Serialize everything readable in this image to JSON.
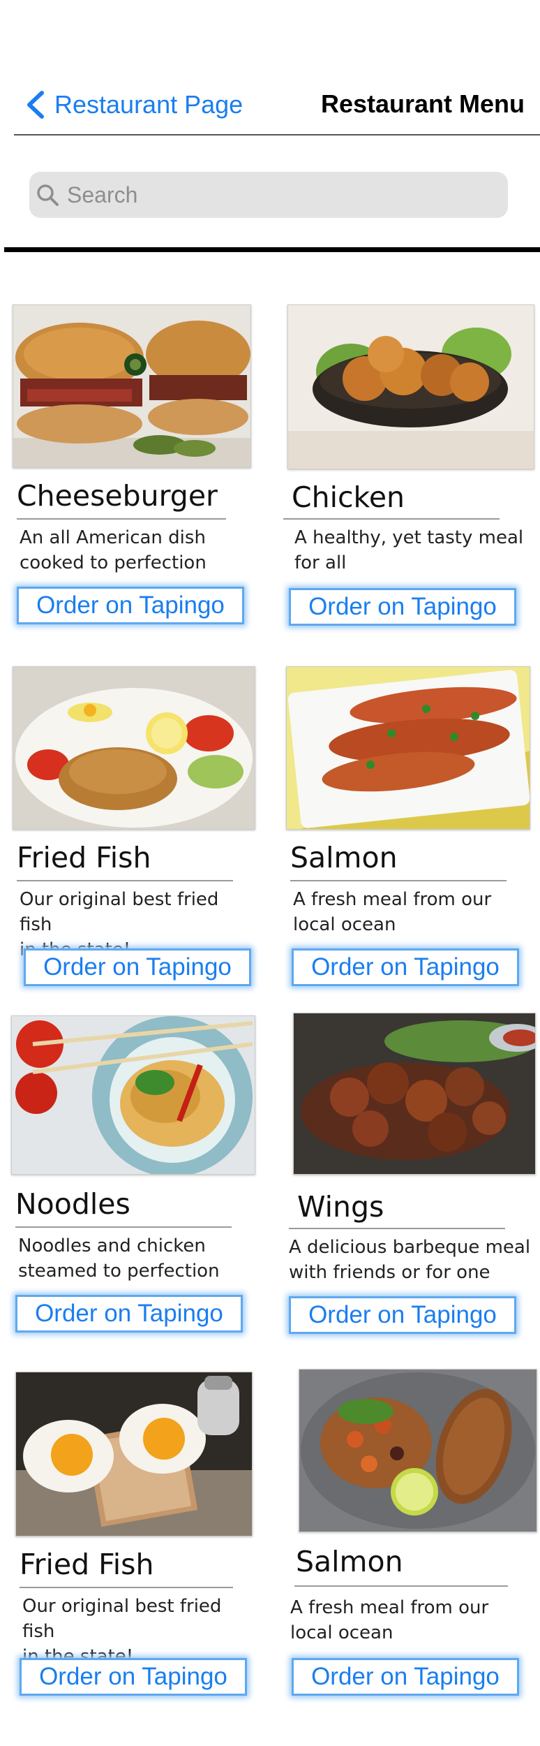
{
  "nav": {
    "back_label": "Restaurant Page",
    "title": "Restaurant Menu"
  },
  "search": {
    "placeholder": "Search"
  },
  "colors": {
    "link_blue": "#1a7ef0",
    "button_glow": "#9ccaf7",
    "search_bg": "#e3e3e3"
  },
  "menu": [
    {
      "name": "Cheeseburger",
      "desc_line1": "An all American dish",
      "desc_line2": "cooked to perfection",
      "button": "Order on Tapingo"
    },
    {
      "name": "Chicken",
      "desc_line1": "A healthy, yet tasty meal",
      "desc_line2": "for all",
      "button": "Order on Tapingo"
    },
    {
      "name": "Fried Fish",
      "desc_line1": "Our original best fried fish",
      "desc_line2": "in the state!",
      "button": "Order on Tapingo"
    },
    {
      "name": "Salmon",
      "desc_line1": "A fresh meal from our",
      "desc_line2": "local ocean",
      "button": "Order on Tapingo"
    },
    {
      "name": "Noodles",
      "desc_line1": "Noodles and chicken",
      "desc_line2": "steamed to perfection",
      "button": "Order on Tapingo"
    },
    {
      "name": "Wings",
      "desc_line1": "A delicious barbeque meal",
      "desc_line2": "with friends or for one",
      "button": "Order on Tapingo"
    },
    {
      "name": "Fried Fish",
      "desc_line1": "Our original best fried fish",
      "desc_line2": "in the state!",
      "button": "Order on Tapingo"
    },
    {
      "name": "Salmon",
      "desc_line1": "A fresh meal from our",
      "desc_line2": "local ocean",
      "button": "Order on Tapingo"
    }
  ]
}
